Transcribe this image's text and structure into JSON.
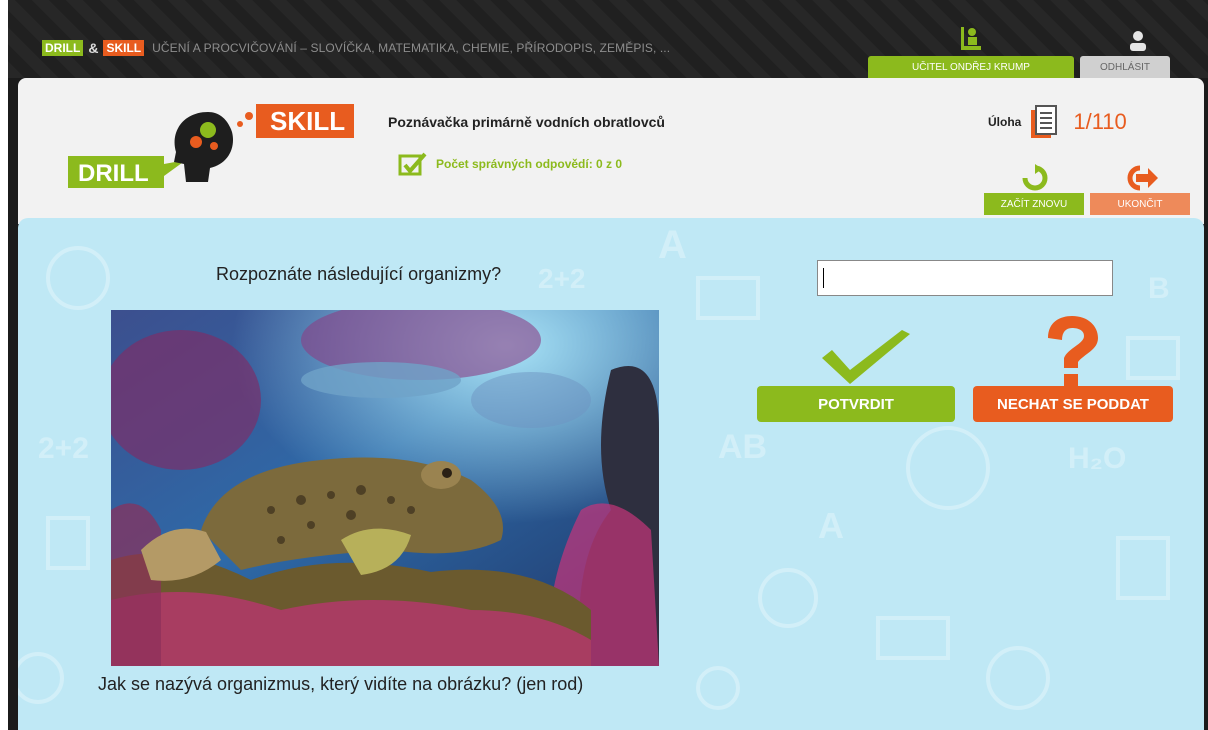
{
  "topbar": {
    "brand_drill": "DRILL",
    "brand_amp": "&",
    "brand_skill": "SKILL",
    "tagline": "UČENÍ A PROCVIČOVÁNÍ – SLOVÍČKA, MATEMATIKA, CHEMIE, PŘÍRODOPIS, ZEMĚPIS, ...",
    "teacher_label": "UČITEL ONDŘEJ KRUMP",
    "logout_label": "ODHLÁSIT"
  },
  "logo": {
    "drill": "DRILL",
    "skill": "SKILL"
  },
  "header": {
    "title": "Poznávačka primárně vodních obratlovců",
    "score": "Počet správných odpovědí: 0 z 0",
    "task_label": "Úloha",
    "task_count": "1/110",
    "restart_label": "ZAČÍT ZNOVU",
    "end_label": "UKONČIT"
  },
  "main": {
    "question": "Rozpoznáte následující organizmy?",
    "answer_value": "",
    "caption": "Jak se nazývá organizmus, který vidíte na obrázku? (jen rod)",
    "confirm_label": "POTVRDIT",
    "giveup_label": "NECHAT SE PODDAT"
  },
  "colors": {
    "green": "#8cba1d",
    "orange": "#e85c1f",
    "panel_blue": "#bfe8f5"
  },
  "icons": [
    "teacher-icon",
    "logout-icon",
    "checkbox-icon",
    "document-stack-icon",
    "restart-icon",
    "exit-icon",
    "checkmark-icon",
    "question-mark-icon"
  ]
}
